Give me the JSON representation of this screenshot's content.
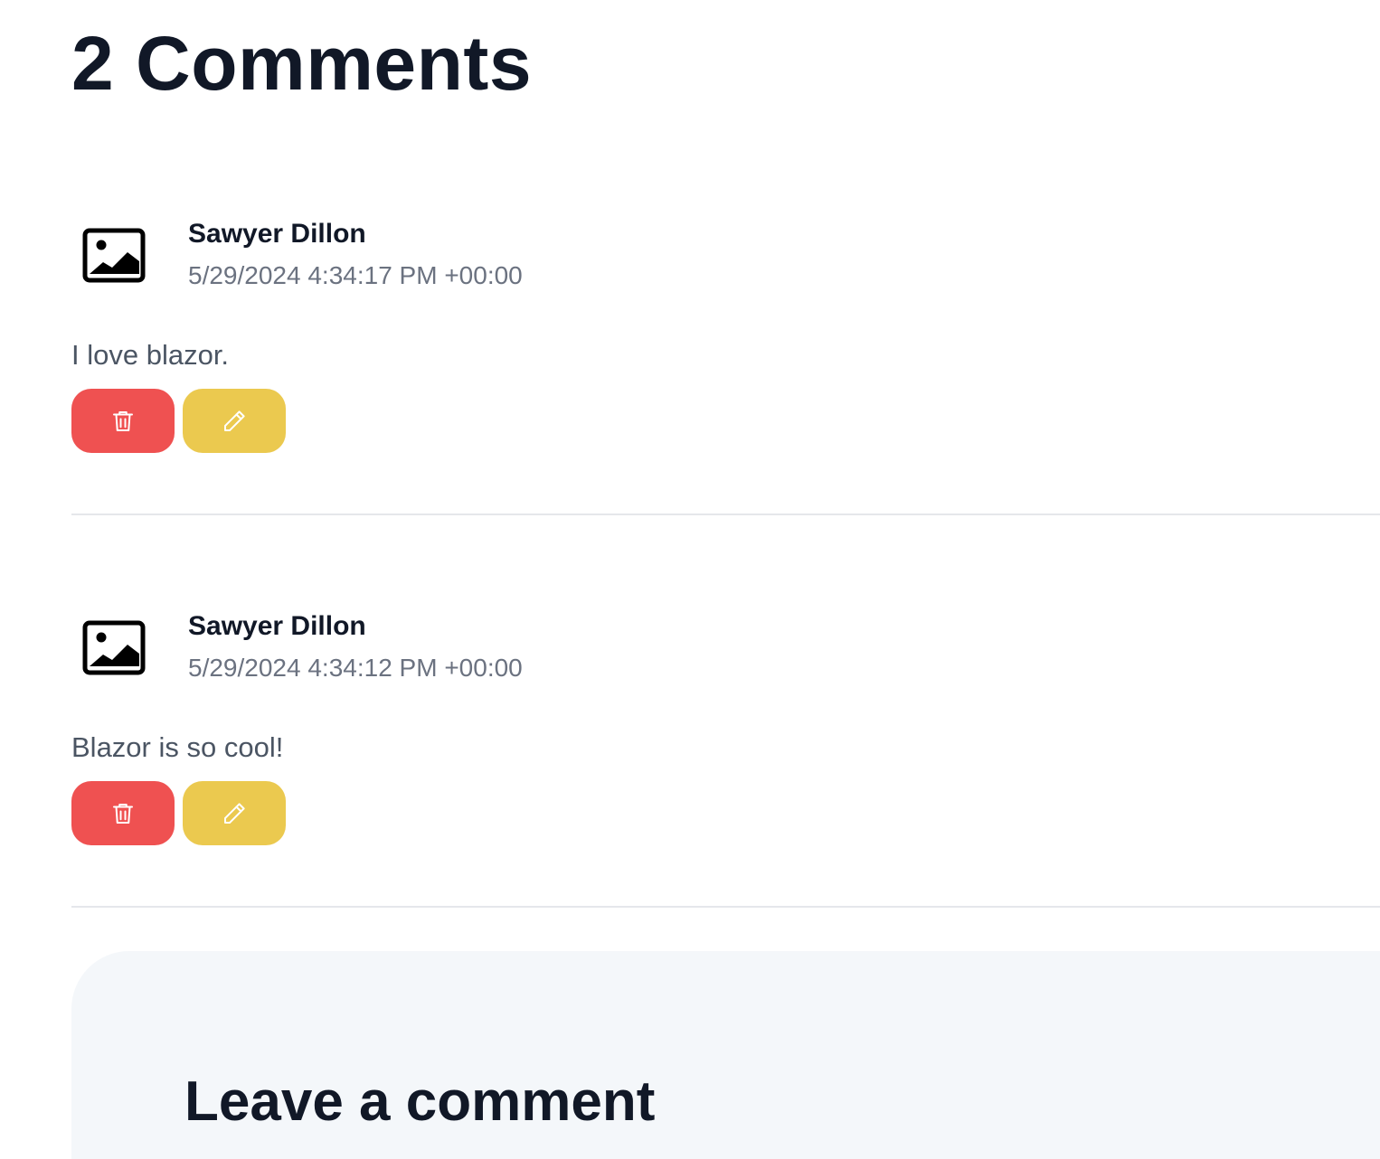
{
  "comments_section": {
    "title": "2 Comments",
    "comments": [
      {
        "author": "Sawyer Dillon",
        "timestamp": "5/29/2024 4:34:17 PM +00:00",
        "text": "I love blazor.",
        "avatar_icon": "image-placeholder-icon",
        "delete_icon": "trash-icon",
        "edit_icon": "pencil-icon"
      },
      {
        "author": "Sawyer Dillon",
        "timestamp": "5/29/2024 4:34:12 PM +00:00",
        "text": "Blazor is so cool!",
        "avatar_icon": "image-placeholder-icon",
        "delete_icon": "trash-icon",
        "edit_icon": "pencil-icon"
      }
    ]
  },
  "leave_comment": {
    "title": "Leave a comment"
  },
  "colors": {
    "delete_button": "#ef5151",
    "edit_button": "#ebc94f",
    "panel_background": "#f4f7fa",
    "muted_text": "#6b7280",
    "heading_text": "#111827"
  }
}
